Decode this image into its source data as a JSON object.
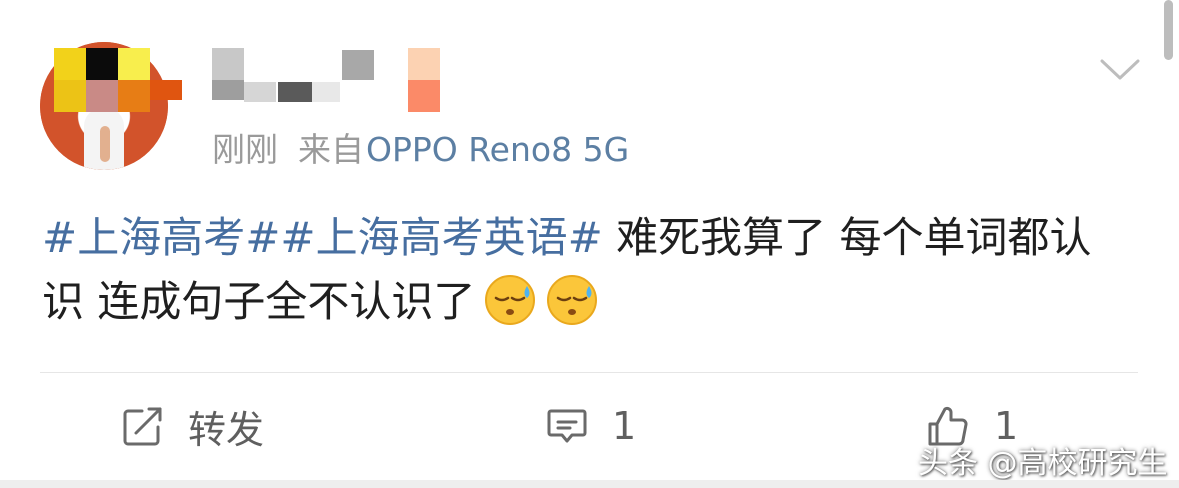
{
  "post": {
    "author": {
      "name": "",
      "avatar_icon": "user-avatar-icon"
    },
    "time": "刚刚",
    "source_prefix": "来自",
    "source_device": "OPPO Reno8 5G",
    "hashtags": [
      "#上海高考#",
      "#上海高考英语#"
    ],
    "text": " 难死我算了 每个单词都认识 连成句子全不认识了",
    "emojis": [
      "sweat-face-icon",
      "sweat-face-icon"
    ],
    "more_icon": "chevron-down-icon"
  },
  "actions": {
    "repost": {
      "icon": "repost-icon",
      "label": "转发"
    },
    "comment": {
      "icon": "comment-icon",
      "count": "1"
    },
    "like": {
      "icon": "thumbs-up-icon",
      "count": "1"
    }
  },
  "watermark": "头条 @高校研究生",
  "colors": {
    "hashtag": "#466ea0",
    "device": "#5c7fa3",
    "meta": "#9a9a9a",
    "text": "#1f1f1f",
    "action": "#5f5f5f"
  }
}
